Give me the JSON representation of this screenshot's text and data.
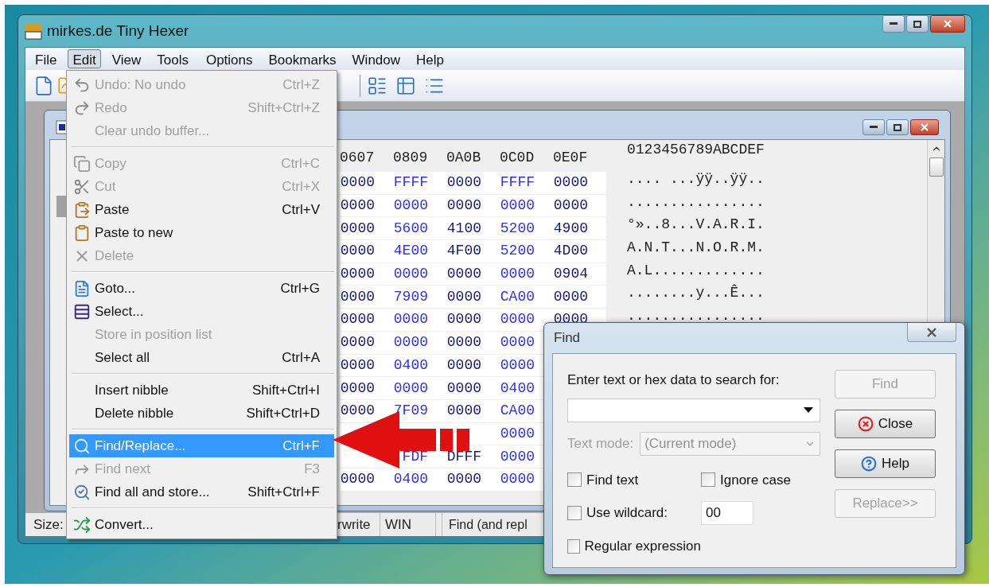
{
  "window": {
    "title": "mirkes.de Tiny Hexer"
  },
  "menu_bar": [
    {
      "label": "File",
      "selected": false
    },
    {
      "label": "Edit",
      "selected": true
    },
    {
      "label": "View",
      "selected": false
    },
    {
      "label": "Tools",
      "selected": false
    },
    {
      "label": "Options",
      "selected": false
    },
    {
      "label": "Bookmarks",
      "selected": false
    },
    {
      "label": "Window",
      "selected": false
    },
    {
      "label": "Help",
      "selected": false
    }
  ],
  "edit_menu": [
    {
      "kind": "item",
      "label": "Undo: No undo",
      "shortcut": "Ctrl+Z",
      "disabled": true,
      "selected": false
    },
    {
      "kind": "item",
      "label": "Redo",
      "shortcut": "Shift+Ctrl+Z",
      "disabled": true,
      "selected": false
    },
    {
      "kind": "item",
      "label": "Clear undo buffer...",
      "disabled": true,
      "selected": false
    },
    {
      "kind": "separator"
    },
    {
      "kind": "item",
      "label": "Copy",
      "shortcut": "Ctrl+C",
      "disabled": true,
      "selected": false
    },
    {
      "kind": "item",
      "label": "Cut",
      "shortcut": "Ctrl+X",
      "disabled": true,
      "selected": false
    },
    {
      "kind": "item",
      "label": "Paste",
      "shortcut": "Ctrl+V",
      "disabled": false,
      "selected": false
    },
    {
      "kind": "item",
      "label": "Paste to new",
      "disabled": false,
      "selected": false
    },
    {
      "kind": "item",
      "label": "Delete",
      "disabled": true,
      "selected": false
    },
    {
      "kind": "separator"
    },
    {
      "kind": "item",
      "label": "Goto...",
      "shortcut": "Ctrl+G",
      "disabled": false,
      "selected": false
    },
    {
      "kind": "item",
      "label": "Select...",
      "disabled": false,
      "selected": false
    },
    {
      "kind": "item",
      "label": "Store in position list",
      "disabled": true,
      "selected": false
    },
    {
      "kind": "item",
      "label": "Select all",
      "shortcut": "Ctrl+A",
      "disabled": false,
      "selected": false
    },
    {
      "kind": "separator"
    },
    {
      "kind": "item",
      "label": "Insert nibble",
      "shortcut": "Shift+Ctrl+I",
      "disabled": false,
      "selected": false
    },
    {
      "kind": "item",
      "label": "Delete nibble",
      "shortcut": "Shift+Ctrl+D",
      "disabled": false,
      "selected": false
    },
    {
      "kind": "separator"
    },
    {
      "kind": "item",
      "label": "Find/Replace...",
      "shortcut": "Ctrl+F",
      "disabled": false,
      "selected": true
    },
    {
      "kind": "item",
      "label": "Find next",
      "shortcut": "F3",
      "disabled": true,
      "selected": false
    },
    {
      "kind": "item",
      "label": "Find all and store...",
      "shortcut": "Shift+Ctrl+F",
      "disabled": false,
      "selected": false
    },
    {
      "kind": "separator"
    },
    {
      "kind": "item",
      "label": "Convert...",
      "disabled": false,
      "selected": false
    }
  ],
  "hex_view": {
    "columns": [
      "0607",
      "0809",
      "0A0B",
      "0C0D",
      "0E0F"
    ],
    "ascii_header": "0123456789ABCDEF",
    "rows": [
      {
        "cells": [
          "0000",
          "FFFF",
          "0000",
          "FFFF",
          "0000"
        ],
        "ascii": ".... ...ÿÿ..ÿÿ.."
      },
      {
        "cells": [
          "0000",
          "0000",
          "0000",
          "0000",
          "0000"
        ],
        "ascii": "................"
      },
      {
        "cells": [
          "0000",
          "5600",
          "4100",
          "5200",
          "4900"
        ],
        "ascii": "°»..8...V.A.R.I."
      },
      {
        "cells": [
          "0000",
          "4E00",
          "4F00",
          "5200",
          "4D00"
        ],
        "ascii": "A.N.T...N.O.R.M."
      },
      {
        "cells": [
          "0000",
          "0000",
          "0000",
          "0000",
          "0904"
        ],
        "ascii": "A.L............."
      },
      {
        "cells": [
          "0000",
          "7909",
          "0000",
          "CA00",
          "0000"
        ],
        "ascii": "........y...Ê..."
      },
      {
        "cells": [
          "0000",
          "0000",
          "0000",
          "0000",
          "0000"
        ],
        "ascii": "................"
      },
      {
        "cells": [
          "0000",
          "0000",
          "0000",
          "0000"
        ]
      },
      {
        "cells": [
          "0000",
          "0400",
          "0000",
          "0000"
        ]
      },
      {
        "cells": [
          "0000",
          "0000",
          "0000",
          "0400"
        ]
      },
      {
        "cells": [
          "0000",
          "7F09",
          "0000",
          "CA00"
        ]
      },
      {
        "cells": [
          null,
          null,
          null,
          "0000"
        ]
      },
      {
        "cells": [
          null,
          "FDF",
          "DFFF",
          "0000"
        ]
      },
      {
        "cells": [
          "0000",
          "0400",
          "0000",
          "0000"
        ]
      }
    ]
  },
  "status_bar": [
    "Size:",
    "rwrite",
    "WIN",
    "Find (and repl"
  ],
  "find_dialog": {
    "title": "Find",
    "search_label": "Enter text or hex data to search for:",
    "text_mode": {
      "label": "Text mode:",
      "value": "(Current mode)",
      "disabled": true
    },
    "options": [
      {
        "label": "Find text",
        "checked": false
      },
      {
        "label": "Ignore case",
        "checked": false
      },
      {
        "label": "Use wildcard:",
        "checked": false
      },
      {
        "label": "Regular expression",
        "checked": false
      }
    ],
    "wildcard_value": "00",
    "buttons": [
      {
        "label": "Find",
        "disabled": true
      },
      {
        "label": "Close",
        "disabled": false
      },
      {
        "label": "Help",
        "disabled": false
      },
      {
        "label": "Replace>>",
        "disabled": true
      }
    ]
  }
}
